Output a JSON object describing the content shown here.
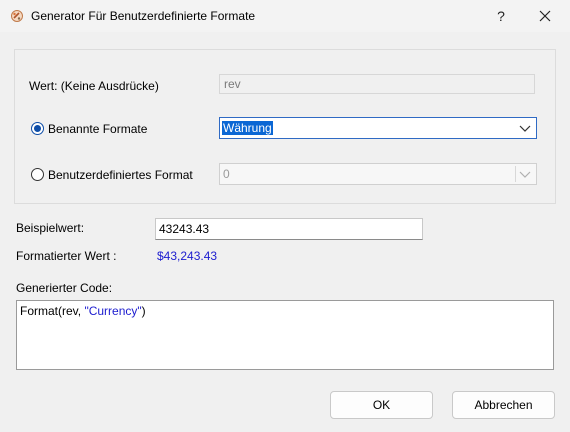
{
  "window": {
    "title": "Generator Für Benutzerdefinierte Formate",
    "icon": "format-generator-icon",
    "help_symbol": "?",
    "close_symbol": "✕"
  },
  "form": {
    "value_label": "Wert: (Keine Ausdrücke)",
    "value_field": "rev",
    "named_formats_label": "Benannte Formate",
    "named_formats_selected": "Währung",
    "named_formats_checked": true,
    "custom_format_label": "Benutzerdefiniertes Format",
    "custom_format_value": "0",
    "custom_format_checked": false
  },
  "sample": {
    "label": "Beispielwert:",
    "value": "43243.43",
    "formatted_label": "Formatierter Wert :",
    "formatted_value": "$43,243.43"
  },
  "code": {
    "label": "Generierter Code:",
    "prefix": "Format(rev, ",
    "string": "\"Currency\"",
    "suffix": ")"
  },
  "buttons": {
    "ok": "OK",
    "cancel": "Abbrechen"
  },
  "colors": {
    "accent": "#0f4ea8",
    "selection": "#0b67d4",
    "value_text": "#1c1ccf"
  }
}
